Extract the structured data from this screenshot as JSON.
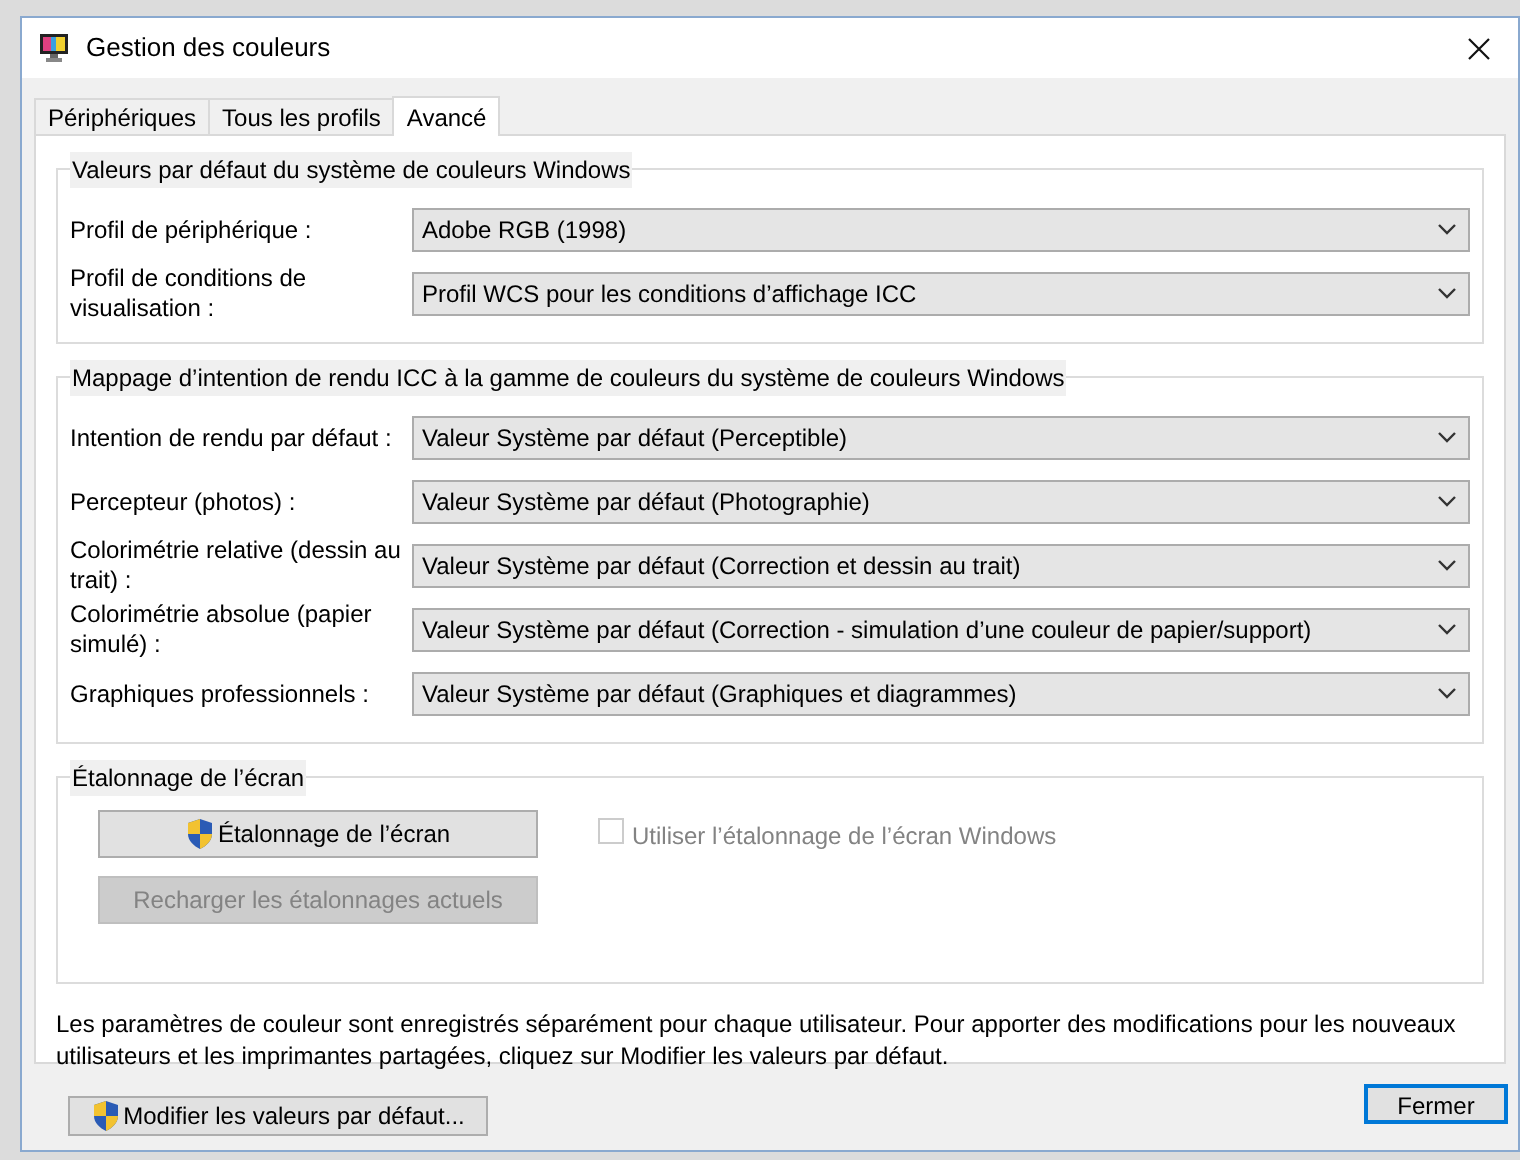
{
  "window": {
    "title": "Gestion des couleurs"
  },
  "tabs": [
    {
      "label": "Périphériques",
      "selected": false
    },
    {
      "label": "Tous les profils",
      "selected": false
    },
    {
      "label": "Avancé",
      "selected": true
    }
  ],
  "default_values": {
    "title": "Valeurs par défaut du système de couleurs Windows",
    "fields": [
      {
        "label": "Profil de périphérique :",
        "value": "Adobe RGB (1998)"
      },
      {
        "label": "Profil de conditions de visualisation :",
        "value": "Profil WCS pour les conditions d’affichage ICC"
      }
    ]
  },
  "rendering_intent": {
    "title": "Mappage d’intention de rendu ICC à la gamme de couleurs du système de couleurs Windows",
    "fields": [
      {
        "label": "Intention de rendu par défaut :",
        "value": "Valeur Système par défaut (Perceptible)"
      },
      {
        "label": "Percepteur (photos) :",
        "value": "Valeur Système par défaut (Photographie)"
      },
      {
        "label": "Colorimétrie relative (dessin au trait) :",
        "value": "Valeur Système par défaut (Correction et dessin au trait)"
      },
      {
        "label": "Colorimétrie absolue (papier simulé) :",
        "value": "Valeur Système par défaut (Correction - simulation d’une couleur de papier/support)"
      },
      {
        "label": "Graphiques professionnels :",
        "value": "Valeur Système par défaut (Graphiques et diagrammes)"
      }
    ]
  },
  "calibration": {
    "title": "Étalonnage de l’écran",
    "buttons": [
      {
        "label": "Étalonnage de l’écran",
        "disabled": false,
        "shield": true
      },
      {
        "label": "Recharger les étalonnages actuels",
        "disabled": true,
        "shield": false
      }
    ],
    "checkbox": {
      "label": "Utiliser l’étalonnage de l’écran Windows",
      "checked": false,
      "disabled": true
    }
  },
  "note": "Les paramètres de couleur sont enregistrés séparément pour chaque utilisateur. Pour apporter des modifications pour les nouveaux utilisateurs et les imprimantes partagées, cliquez sur Modifier les valeurs par défaut.",
  "defaults_button": {
    "label": "Modifier les valeurs par défaut...",
    "shield": true
  },
  "close_button": {
    "label": "Fermer"
  }
}
